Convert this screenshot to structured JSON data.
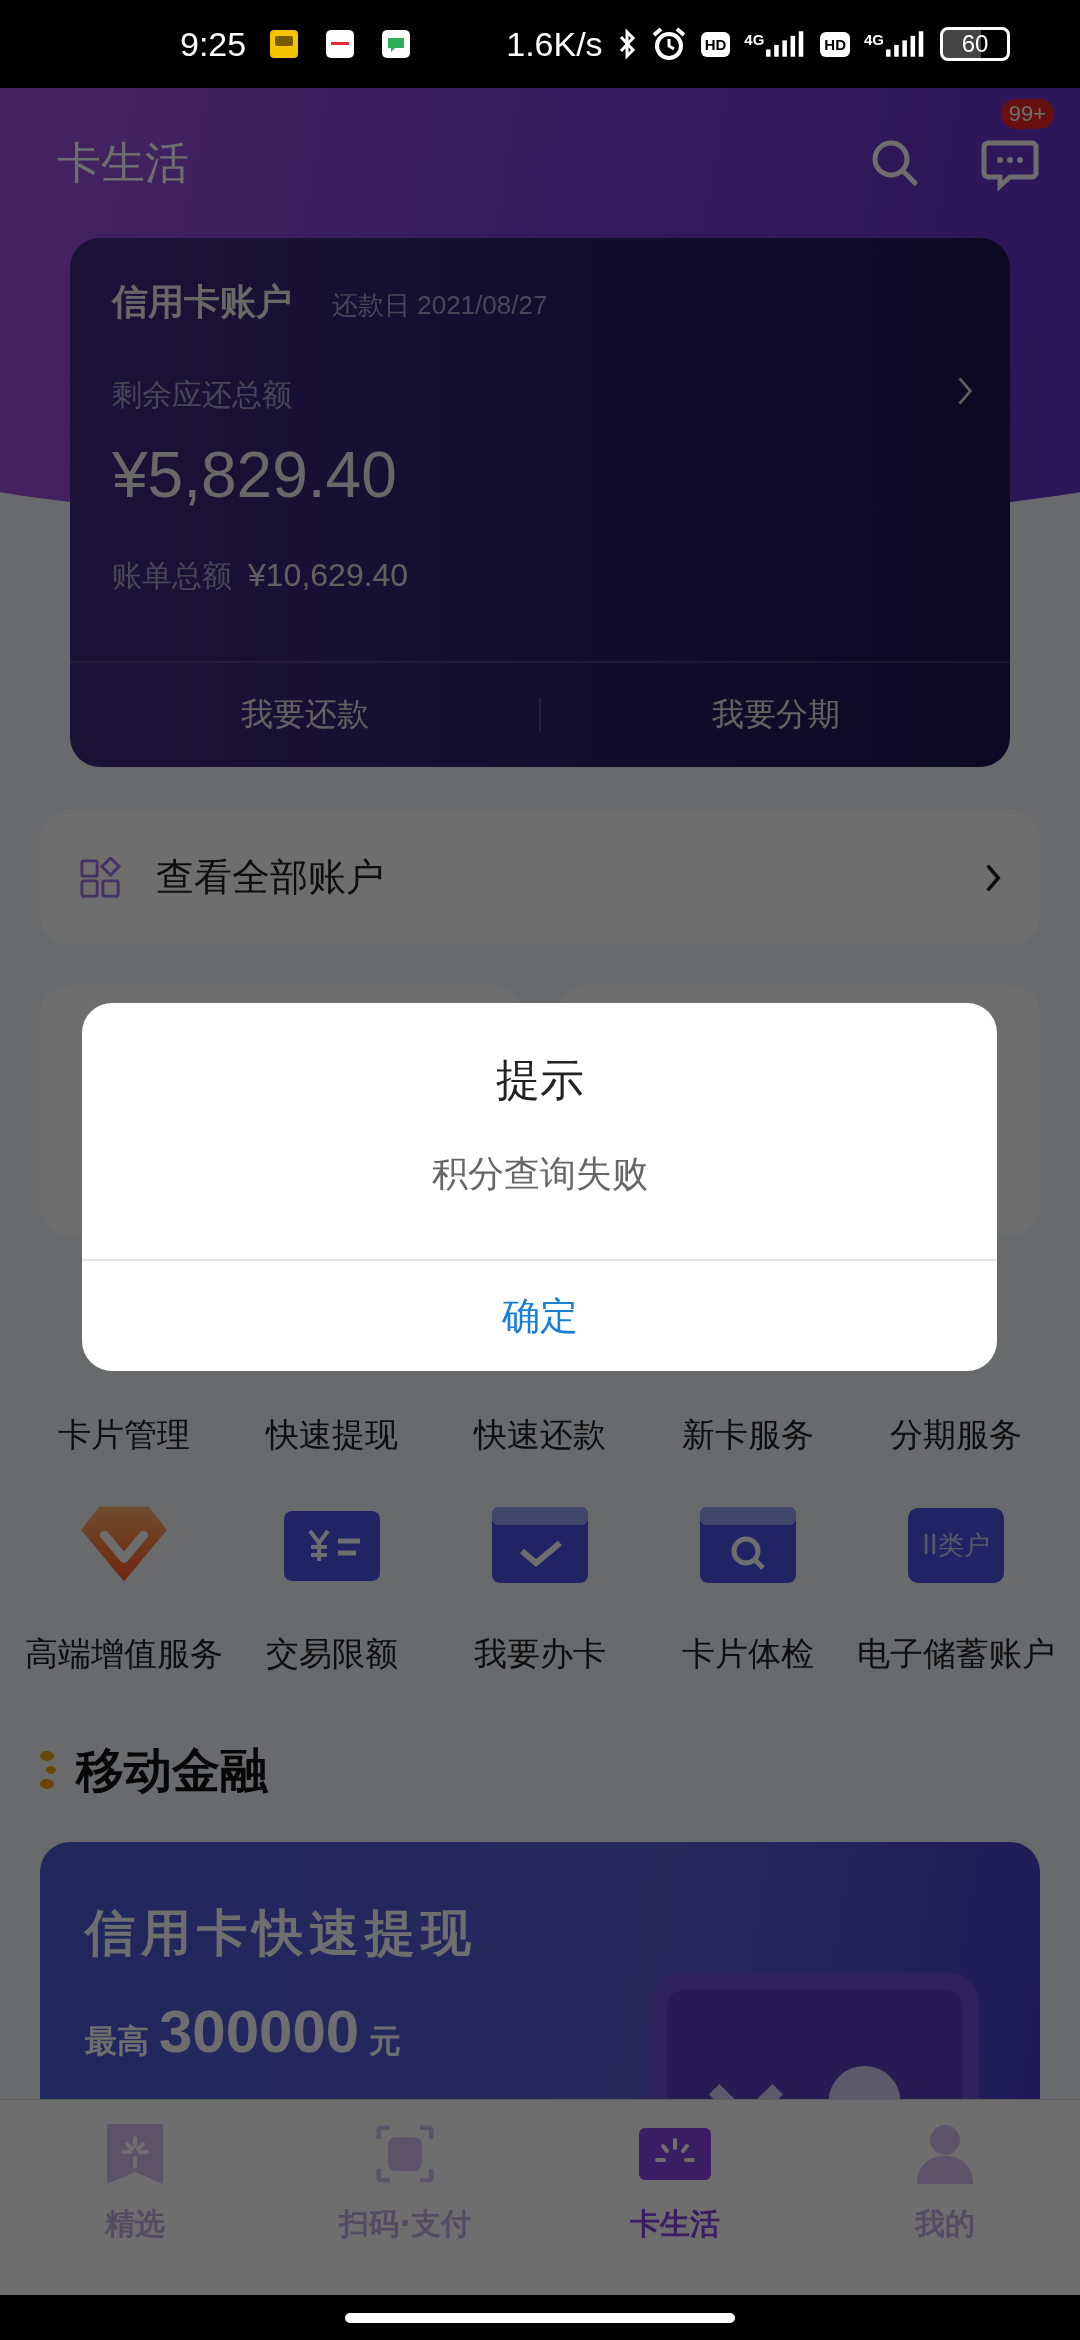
{
  "status_bar": {
    "time": "9:25",
    "speed": "1.6K/s",
    "sims": [
      {
        "hd": "HD",
        "network": "4G"
      },
      {
        "hd": "HD",
        "network": "4G"
      }
    ],
    "battery": "60"
  },
  "header": {
    "title": "卡生活",
    "message_badge": "99+"
  },
  "credit_account": {
    "title": "信用卡账户",
    "due_date": "还款日 2021/08/27",
    "remaining_label": "剩余应还总额",
    "remaining_amount": "¥5,829.40",
    "bill_label": "账单总额",
    "bill_amount": "¥10,629.40",
    "actions": [
      "我要还款",
      "我要分期"
    ]
  },
  "all_accounts": {
    "label": "查看全部账户"
  },
  "services": [
    [
      {
        "label": "卡片管理"
      },
      {
        "label": "快速提现"
      },
      {
        "label": "快速还款"
      },
      {
        "label": "新卡服务"
      },
      {
        "label": "分期服务"
      }
    ],
    [
      {
        "label": "高端增值服务",
        "kind": "diamond"
      },
      {
        "label": "交易限额",
        "kind": "yen"
      },
      {
        "label": "我要办卡",
        "kind": "check"
      },
      {
        "label": "卡片体检",
        "kind": "search"
      },
      {
        "label": "电子储蓄账户",
        "kind": "text",
        "icon_text": "II类户"
      }
    ]
  ],
  "section": {
    "title": "移动金融"
  },
  "banner": {
    "title": "信用卡快速提现",
    "prefix": "最高",
    "amount": "300000",
    "unit": "元"
  },
  "dialog": {
    "title": "提示",
    "message": "积分查询失败",
    "button": "确定"
  },
  "bottom_nav": [
    {
      "label": "精选",
      "kind": "bookmark",
      "selected": false
    },
    {
      "label": "扫码·支付",
      "kind": "scan",
      "selected": false
    },
    {
      "label": "卡生活",
      "kind": "card",
      "selected": true
    },
    {
      "label": "我的",
      "kind": "person",
      "selected": false
    }
  ]
}
